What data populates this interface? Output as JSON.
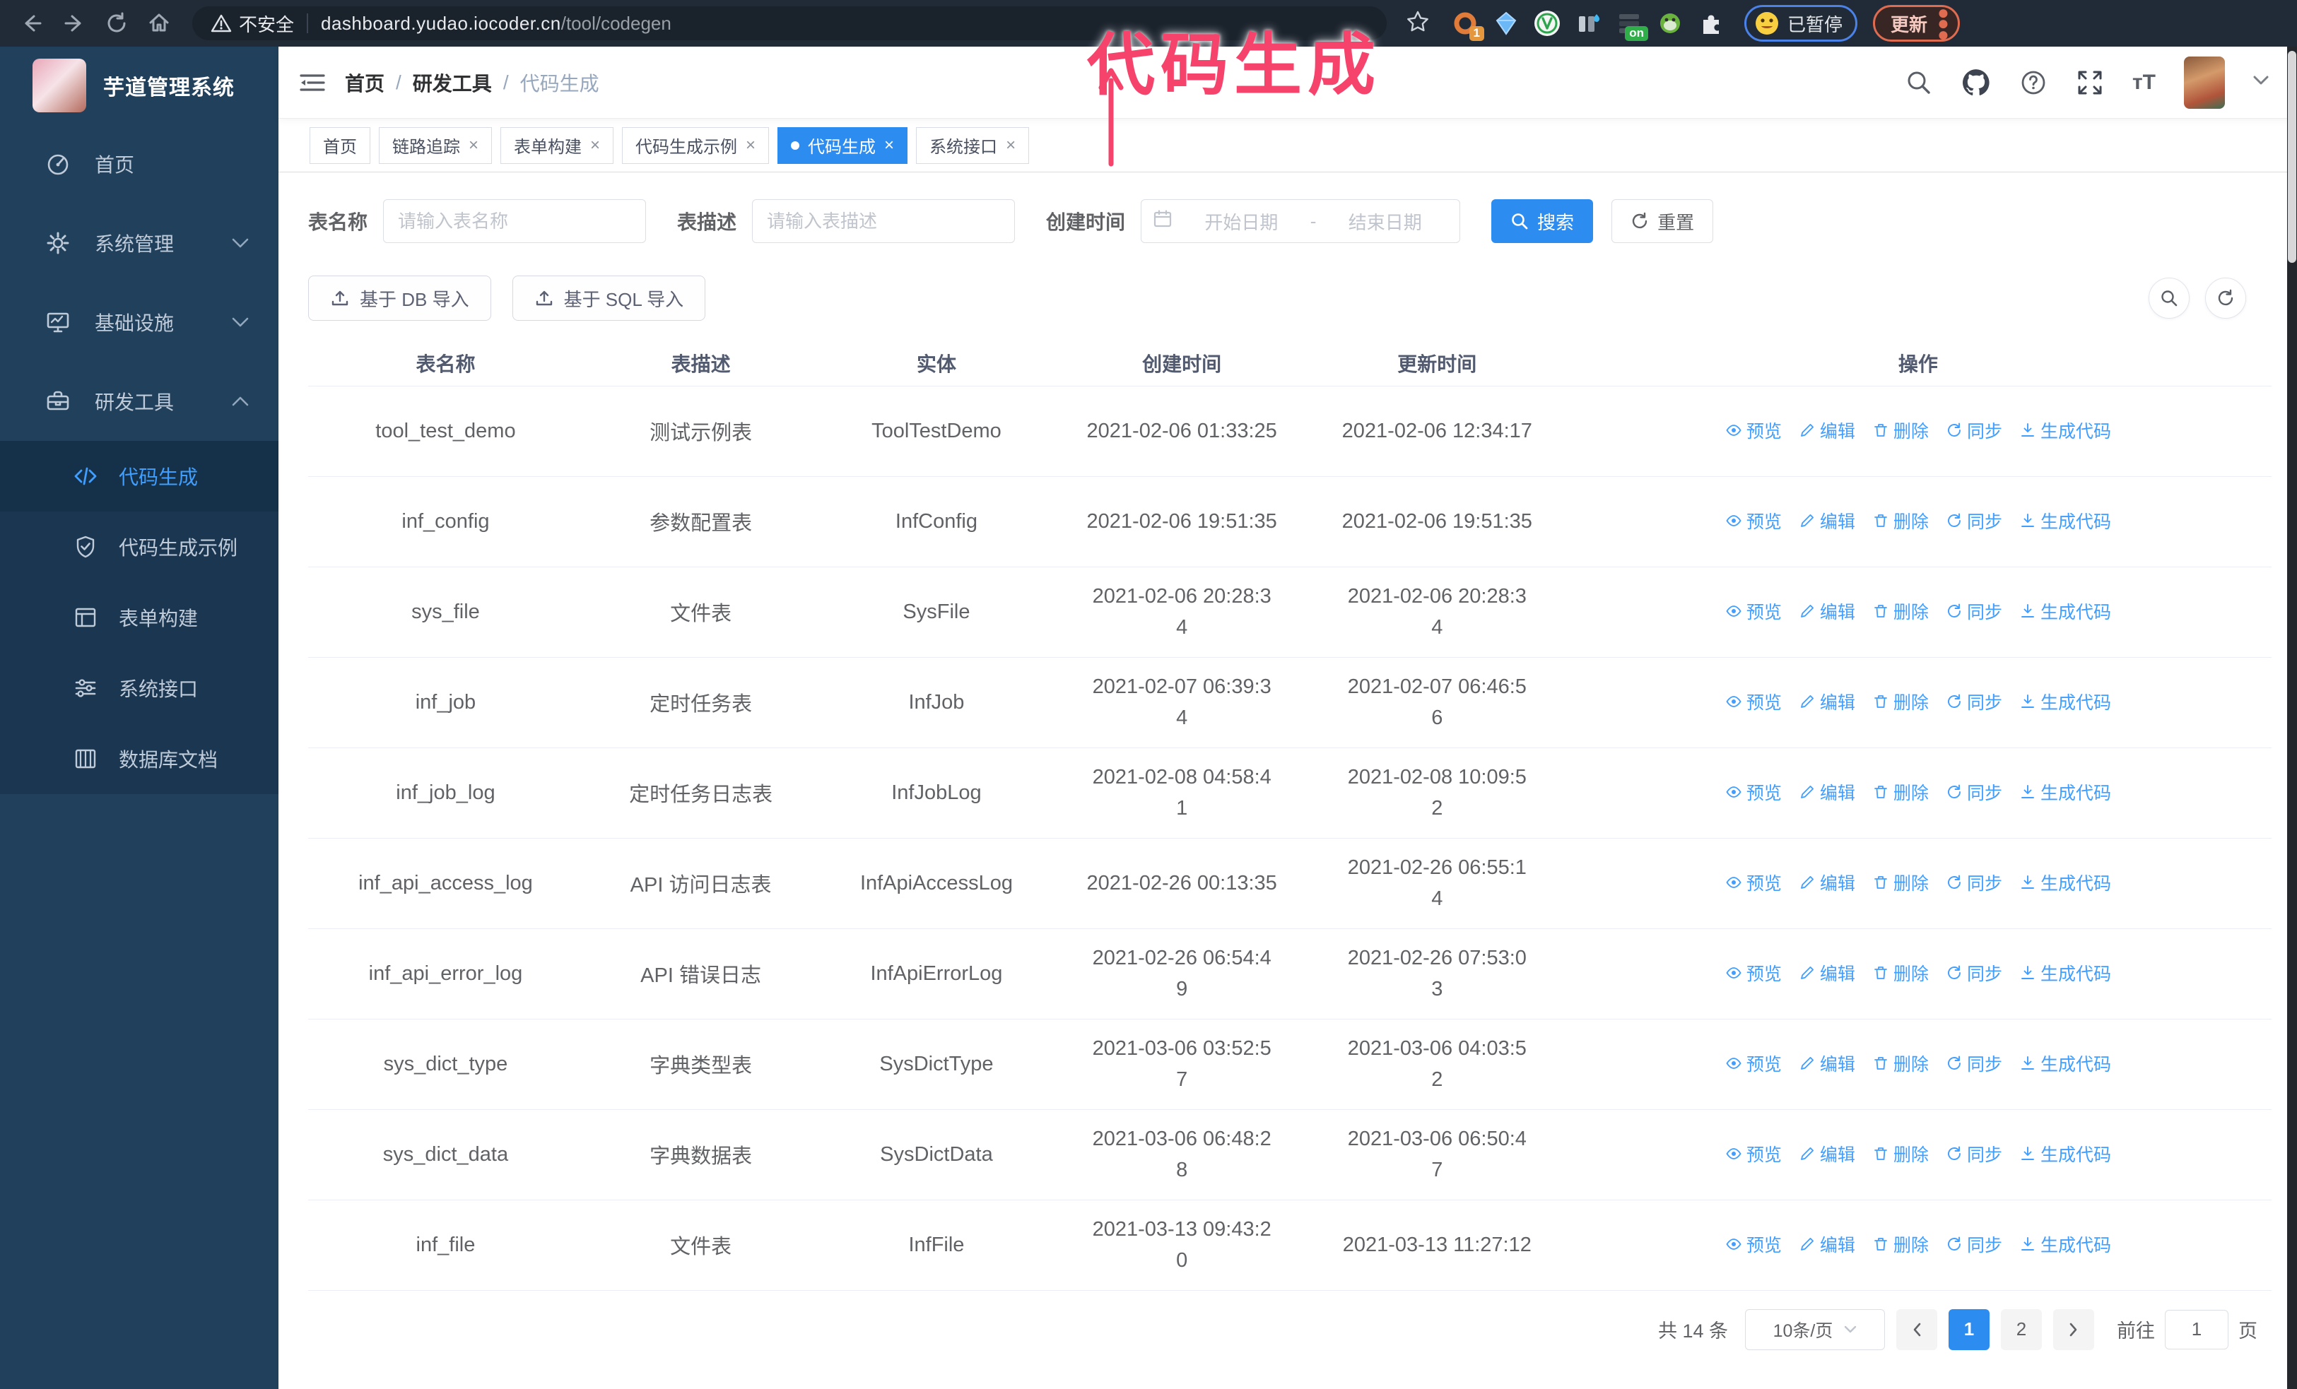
{
  "browser": {
    "security_label": "不安全",
    "url_domain": "dashboard.yudao.iocoder.cn",
    "url_path": "/tool/codegen",
    "ext_badge_count": "1",
    "ext_badge_on": "on",
    "paused_badge": "已暂停",
    "update_label": "更新"
  },
  "annotation": {
    "text": "代码生成",
    "color": "#f5436b"
  },
  "sidebar": {
    "title": "芋道管理系统",
    "items": [
      {
        "label": "首页",
        "icon": "dashboard-icon"
      },
      {
        "label": "系统管理",
        "icon": "gear-icon",
        "chevron": "down"
      },
      {
        "label": "基础设施",
        "icon": "monitor-icon",
        "chevron": "down"
      },
      {
        "label": "研发工具",
        "icon": "toolbox-icon",
        "chevron": "up"
      }
    ],
    "subitems": [
      {
        "label": "代码生成",
        "icon": "code-icon",
        "active": true
      },
      {
        "label": "代码生成示例",
        "icon": "shield-check-icon"
      },
      {
        "label": "表单构建",
        "icon": "form-icon"
      },
      {
        "label": "系统接口",
        "icon": "sliders-icon"
      },
      {
        "label": "数据库文档",
        "icon": "database-icon"
      }
    ]
  },
  "header": {
    "breadcrumb": [
      "首页",
      "研发工具",
      "代码生成"
    ]
  },
  "tabs": [
    {
      "label": "首页"
    },
    {
      "label": "链路追踪"
    },
    {
      "label": "表单构建"
    },
    {
      "label": "代码生成示例"
    },
    {
      "label": "代码生成",
      "active": true
    },
    {
      "label": "系统接口"
    }
  ],
  "filters": {
    "name_label": "表名称",
    "name_placeholder": "请输入表名称",
    "desc_label": "表描述",
    "desc_placeholder": "请输入表描述",
    "time_label": "创建时间",
    "start_placeholder": "开始日期",
    "range_separator": "-",
    "end_placeholder": "结束日期",
    "search_label": "搜索",
    "reset_label": "重置"
  },
  "toolbar": {
    "db_import_label": "基于 DB 导入",
    "sql_import_label": "基于 SQL 导入"
  },
  "table": {
    "headers": [
      "表名称",
      "表描述",
      "实体",
      "创建时间",
      "更新时间",
      "操作"
    ],
    "actions": [
      {
        "label": "预览",
        "icon": "eye",
        "name": "preview-link"
      },
      {
        "label": "编辑",
        "icon": "edit",
        "name": "edit-link"
      },
      {
        "label": "删除",
        "icon": "trash",
        "name": "delete-link"
      },
      {
        "label": "同步",
        "icon": "sync",
        "name": "sync-link"
      },
      {
        "label": "生成代码",
        "icon": "download",
        "name": "generate-code-link"
      }
    ],
    "rows": [
      {
        "name": "tool_test_demo",
        "desc": "测试示例表",
        "entity": "ToolTestDemo",
        "created": "2021-02-06 01:33:25",
        "updated": "2021-02-06 12:34:17"
      },
      {
        "name": "inf_config",
        "desc": "参数配置表",
        "entity": "InfConfig",
        "created": "2021-02-06 19:51:35",
        "updated": "2021-02-06 19:51:35"
      },
      {
        "name": "sys_file",
        "desc": "文件表",
        "entity": "SysFile",
        "created": "2021-02-06 20:28:3\n4",
        "updated": "2021-02-06 20:28:3\n4"
      },
      {
        "name": "inf_job",
        "desc": "定时任务表",
        "entity": "InfJob",
        "created": "2021-02-07 06:39:3\n4",
        "updated": "2021-02-07 06:46:5\n6"
      },
      {
        "name": "inf_job_log",
        "desc": "定时任务日志表",
        "entity": "InfJobLog",
        "created": "2021-02-08 04:58:4\n1",
        "updated": "2021-02-08 10:09:5\n2"
      },
      {
        "name": "inf_api_access_log",
        "desc": "API 访问日志表",
        "entity": "InfApiAccessLog",
        "created": "2021-02-26 00:13:35",
        "updated": "2021-02-26 06:55:1\n4"
      },
      {
        "name": "inf_api_error_log",
        "desc": "API 错误日志",
        "entity": "InfApiErrorLog",
        "created": "2021-02-26 06:54:4\n9",
        "updated": "2021-02-26 07:53:0\n3"
      },
      {
        "name": "sys_dict_type",
        "desc": "字典类型表",
        "entity": "SysDictType",
        "created": "2021-03-06 03:52:5\n7",
        "updated": "2021-03-06 04:03:5\n2"
      },
      {
        "name": "sys_dict_data",
        "desc": "字典数据表",
        "entity": "SysDictData",
        "created": "2021-03-06 06:48:2\n8",
        "updated": "2021-03-06 06:50:4\n7"
      },
      {
        "name": "inf_file",
        "desc": "文件表",
        "entity": "InfFile",
        "created": "2021-03-13 09:43:2\n0",
        "updated": "2021-03-13 11:27:12"
      }
    ]
  },
  "pagination": {
    "total": "共 14 条",
    "page_size": "10条/页",
    "pages": [
      "1",
      "2"
    ],
    "active_page": "1",
    "goto_label": "前往",
    "goto_value": "1",
    "page_unit": "页"
  },
  "colors": {
    "accent": "#2d8cf0",
    "link": "#409eff",
    "sidebar_bg": "#20405c",
    "submenu_bg": "#1a3650",
    "annotation": "#f5436b",
    "browser_bar": "#212b38"
  }
}
